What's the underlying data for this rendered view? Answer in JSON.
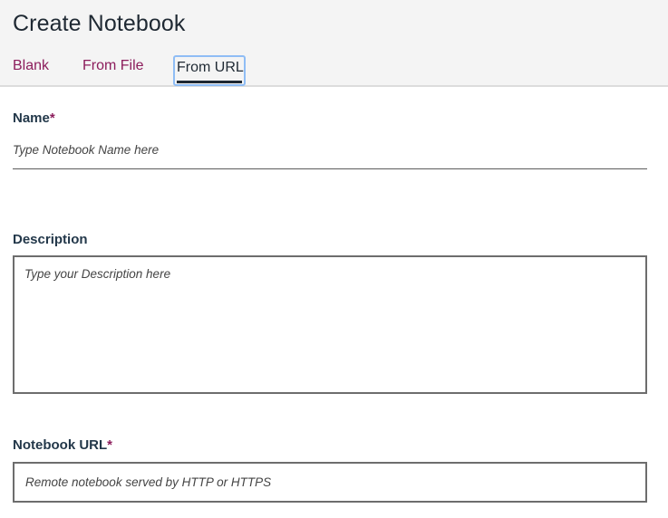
{
  "header": {
    "title": "Create Notebook",
    "tabs": [
      {
        "label": "Blank",
        "selected": false
      },
      {
        "label": "From File",
        "selected": false
      },
      {
        "label": "From URL",
        "selected": true
      }
    ]
  },
  "form": {
    "name": {
      "label": "Name",
      "required_mark": "*",
      "value": "",
      "placeholder": "Type Notebook Name here"
    },
    "description": {
      "label": "Description",
      "value": "",
      "placeholder": "Type your Description here"
    },
    "notebook_url": {
      "label": "Notebook URL",
      "required_mark": "*",
      "value": "",
      "placeholder": "Remote notebook served by HTTP or HTTPS"
    }
  },
  "colors": {
    "accent": "#8c1d5c",
    "focus_ring": "#8fbdf5",
    "header_bg": "#f4f4f4",
    "label_text": "#23384a"
  }
}
